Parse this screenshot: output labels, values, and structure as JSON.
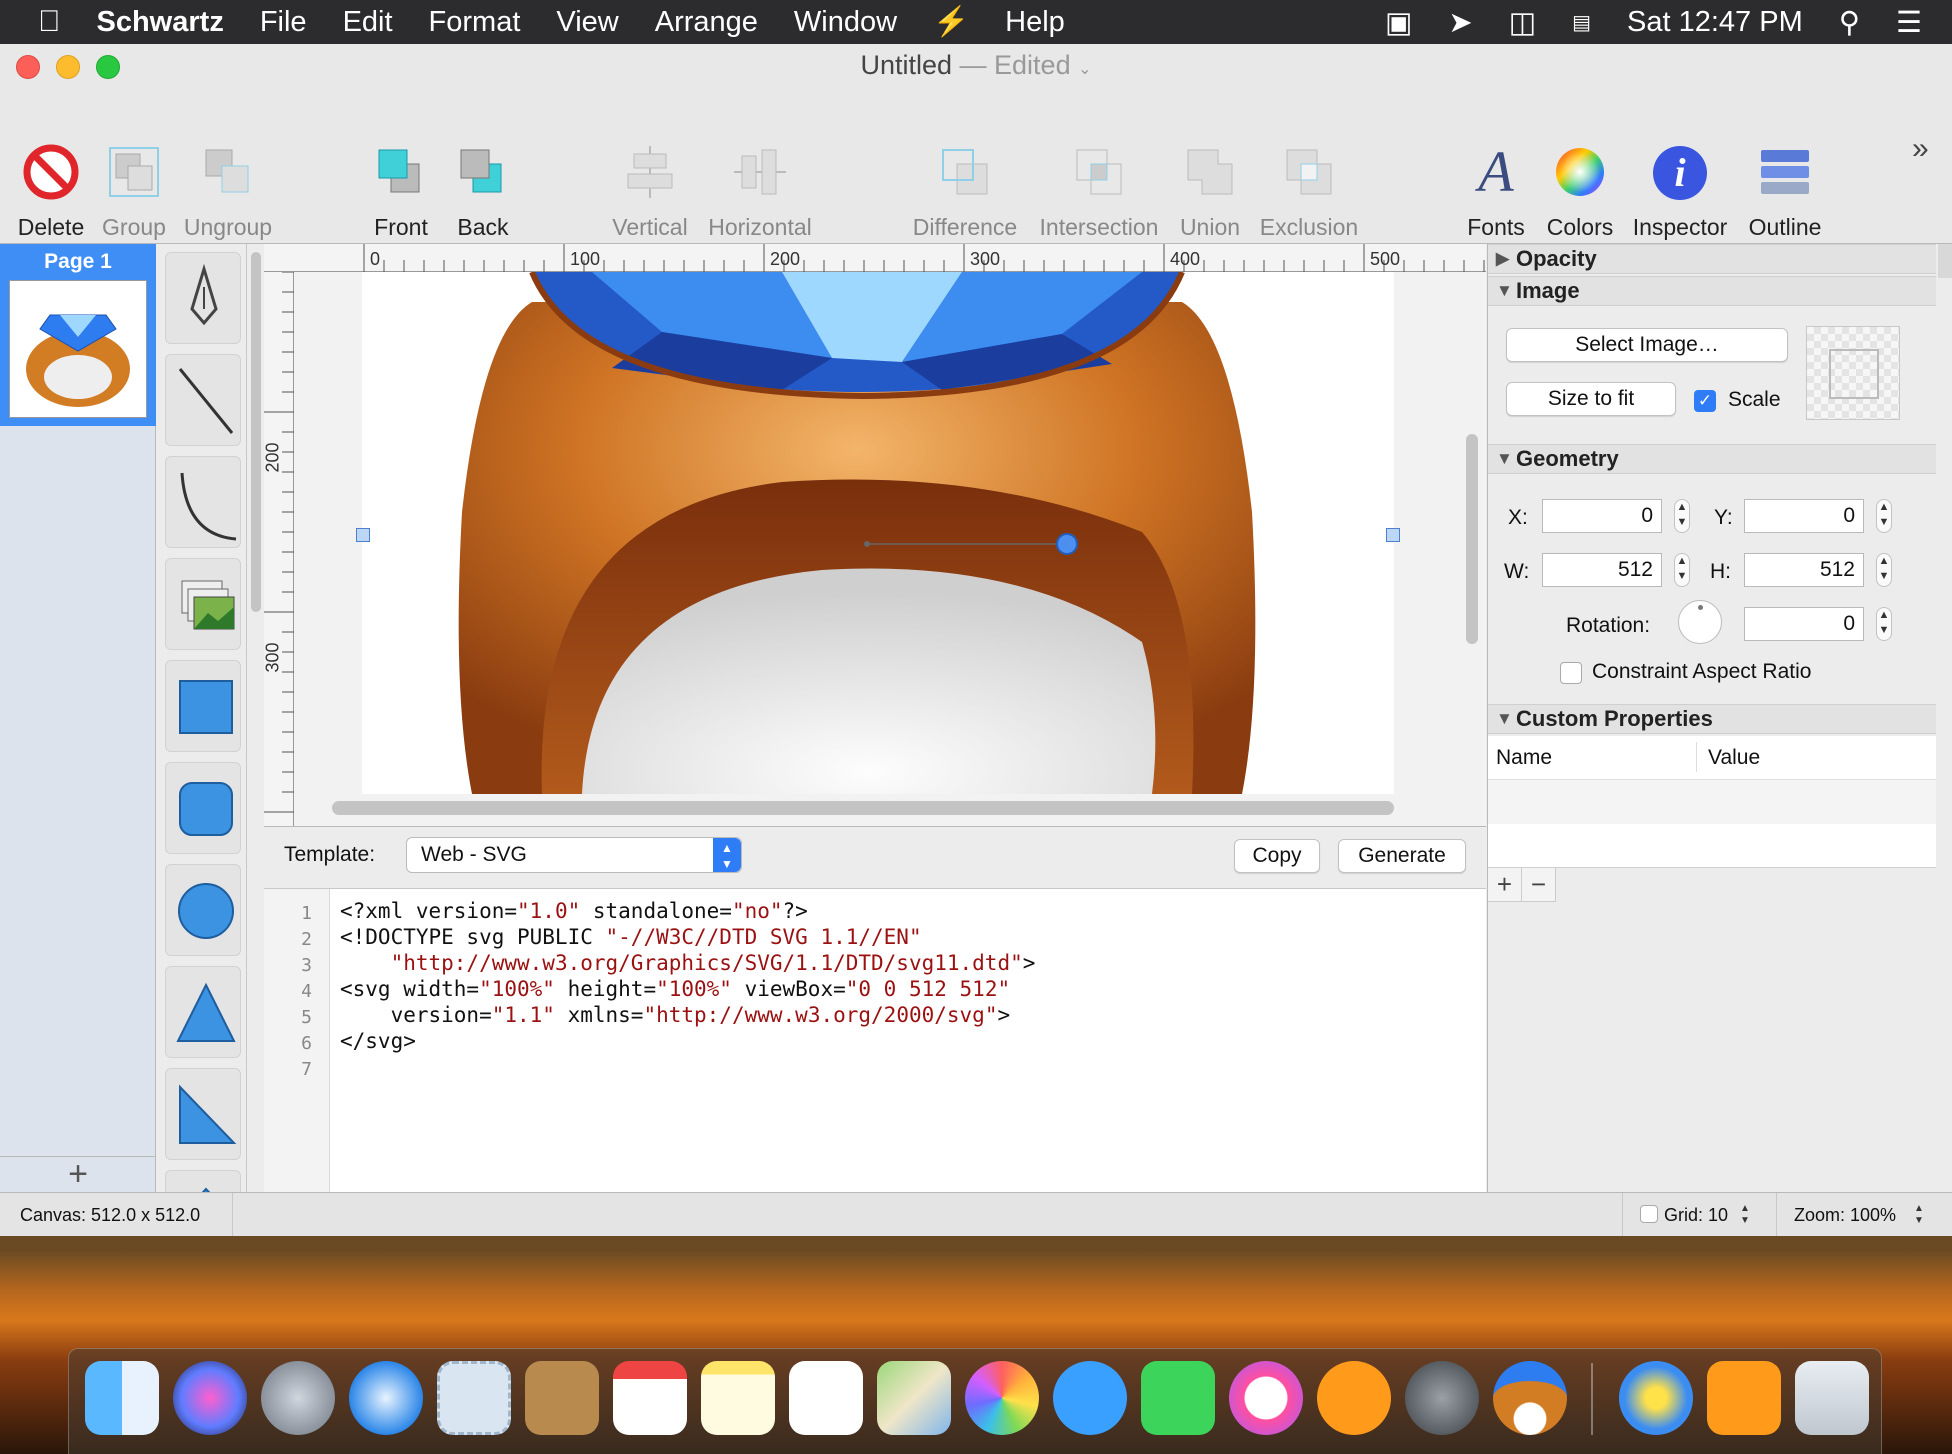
{
  "menubar": {
    "app": "Schwartz",
    "items": [
      "File",
      "Edit",
      "Format",
      "View",
      "Arrange",
      "Window",
      "Help"
    ],
    "clock": "Sat 12:47 PM"
  },
  "window": {
    "title": "Untitled",
    "status": "— Edited"
  },
  "toolbar": {
    "delete": "Delete",
    "group": "Group",
    "ungroup": "Ungroup",
    "front": "Front",
    "back": "Back",
    "vertical": "Vertical",
    "horizontal": "Horizontal",
    "difference": "Difference",
    "intersection": "Intersection",
    "union": "Union",
    "exclusion": "Exclusion",
    "fonts": "Fonts",
    "colors": "Colors",
    "inspector": "Inspector",
    "outline": "Outline",
    "overflow": "»"
  },
  "pages": {
    "page1": "Page 1",
    "add": "+"
  },
  "ruler": {
    "h": [
      "0",
      "100",
      "200",
      "300",
      "400",
      "500"
    ],
    "v": [
      "200",
      "300"
    ]
  },
  "template": {
    "label": "Template:",
    "value": "Web - SVG",
    "copy": "Copy",
    "generate": "Generate"
  },
  "code": {
    "lines": [
      "1",
      "2",
      "3",
      "4",
      "5",
      "6",
      "7"
    ]
  },
  "inspector": {
    "opacity": "Opacity",
    "image": "Image",
    "select_image": "Select Image…",
    "size_to_fit": "Size to fit",
    "scale": "Scale",
    "geometry": "Geometry",
    "x_label": "X:",
    "x": "0",
    "y_label": "Y:",
    "y": "0",
    "w_label": "W:",
    "w": "512",
    "h_label": "H:",
    "h": "512",
    "rotation_label": "Rotation:",
    "rotation": "0",
    "constraint": "Constraint Aspect Ratio",
    "custom": "Custom Properties",
    "col_name": "Name",
    "col_value": "Value",
    "add": "+",
    "remove": "−"
  },
  "status": {
    "canvas": "Canvas: 512.0 x 512.0",
    "grid": "Grid: 10",
    "zoom": "Zoom:  100%"
  },
  "colors": {
    "accent": "#3e8ef6",
    "gem": "#1d63d6",
    "gold": "#c8741f",
    "string": "#9b1111"
  }
}
